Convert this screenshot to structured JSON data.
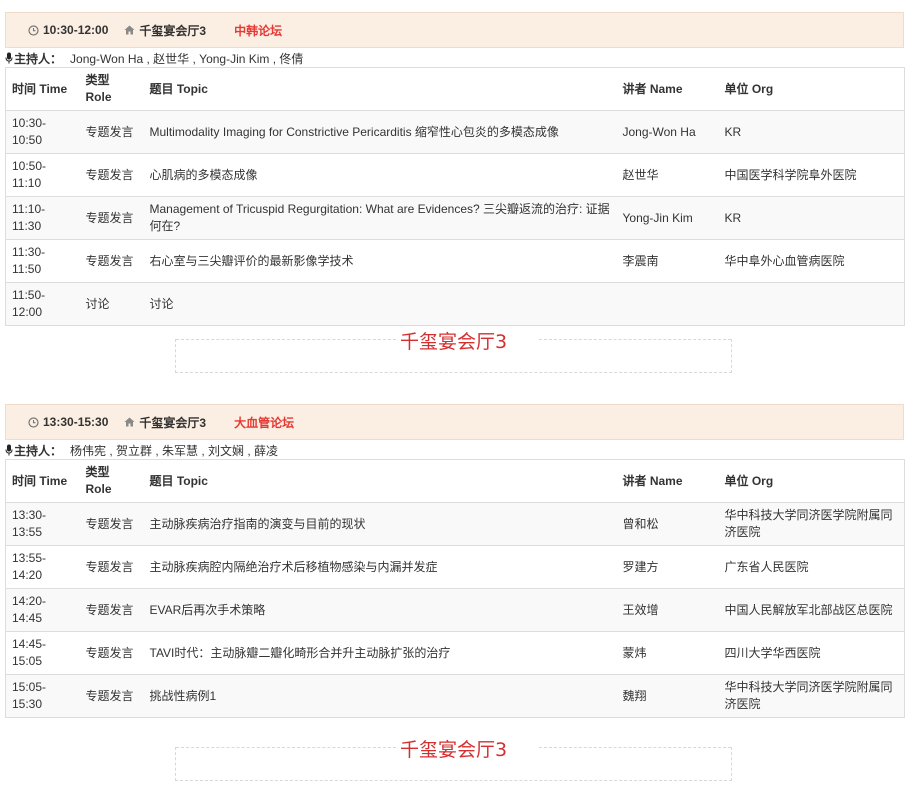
{
  "sessions": [
    {
      "time": "10:30-12:00",
      "venue": "千玺宴会厅3",
      "forum": "中韩论坛",
      "host_label": "主持人：",
      "hosts": "Jong-Won Ha , 赵世华 , Yong-Jin Kim , 佟倩",
      "columns": [
        "时间 Time",
        "类型 Role",
        "题目 Topic",
        "讲者 Name",
        "单位 Org"
      ],
      "rows": [
        {
          "time": "10:30-10:50",
          "role": "专题发言",
          "topic": "Multimodality Imaging for Constrictive Pericarditis 缩窄性心包炎的多模态成像",
          "speaker": "Jong-Won Ha",
          "org": "KR"
        },
        {
          "time": "10:50-11:10",
          "role": "专题发言",
          "topic": "心肌病的多模态成像",
          "speaker": "赵世华",
          "org": "中国医学科学院阜外医院"
        },
        {
          "time": "11:10-11:30",
          "role": "专题发言",
          "topic": "Management of Tricuspid Regurgitation: What are Evidences? 三尖瓣返流的治疗: 证据何在?",
          "speaker": "Yong-Jin Kim",
          "org": "KR"
        },
        {
          "time": "11:30-11:50",
          "role": "专题发言",
          "topic": "右心室与三尖瓣评价的最新影像学技术",
          "speaker": "李震南",
          "org": "华中阜外心血管病医院"
        },
        {
          "time": "11:50-12:00",
          "role": "讨论",
          "topic": "讨论",
          "speaker": "",
          "org": ""
        }
      ]
    },
    {
      "time": "13:30-15:30",
      "venue": "千玺宴会厅3",
      "forum": "大血管论坛",
      "host_label": "主持人：",
      "hosts": "杨伟宪 , 贺立群 , 朱军慧 , 刘文娴 , 薛凌",
      "columns": [
        "时间 Time",
        "类型 Role",
        "题目 Topic",
        "讲者 Name",
        "单位 Org"
      ],
      "rows": [
        {
          "time": "13:30-13:55",
          "role": "专题发言",
          "topic": "主动脉疾病治疗指南的演变与目前的现状",
          "speaker": "曾和松",
          "org": "华中科技大学同济医学院附属同济医院"
        },
        {
          "time": "13:55-14:20",
          "role": "专题发言",
          "topic": "主动脉疾病腔内隔绝治疗术后移植物感染与内漏并发症",
          "speaker": "罗建方",
          "org": "广东省人民医院"
        },
        {
          "time": "14:20-14:45",
          "role": "专题发言",
          "topic": "EVAR后再次手术策略",
          "speaker": "王效增",
          "org": "中国人民解放军北部战区总医院"
        },
        {
          "time": "14:45-15:05",
          "role": "专题发言",
          "topic": "TAVI时代：主动脉瓣二瓣化畸形合并升主动脉扩张的治疗",
          "speaker": "蒙炜",
          "org": "四川大学华西医院"
        },
        {
          "time": "15:05-15:30",
          "role": "专题发言",
          "topic": "挑战性病例1",
          "speaker": "魏翔",
          "org": "华中科技大学同济医学院附属同济医院"
        }
      ]
    }
  ],
  "venue_labels": [
    "千玺宴会厅3",
    "千玺宴会厅3"
  ],
  "colors": {
    "header_bg": "#fbeee2",
    "forum_red": "#e53935",
    "venue_red": "#d32f2f",
    "row_alt": "#f9f9f9",
    "border": "#dddddd"
  },
  "icons": [
    "clock-icon",
    "home-icon",
    "microphone-icon"
  ]
}
